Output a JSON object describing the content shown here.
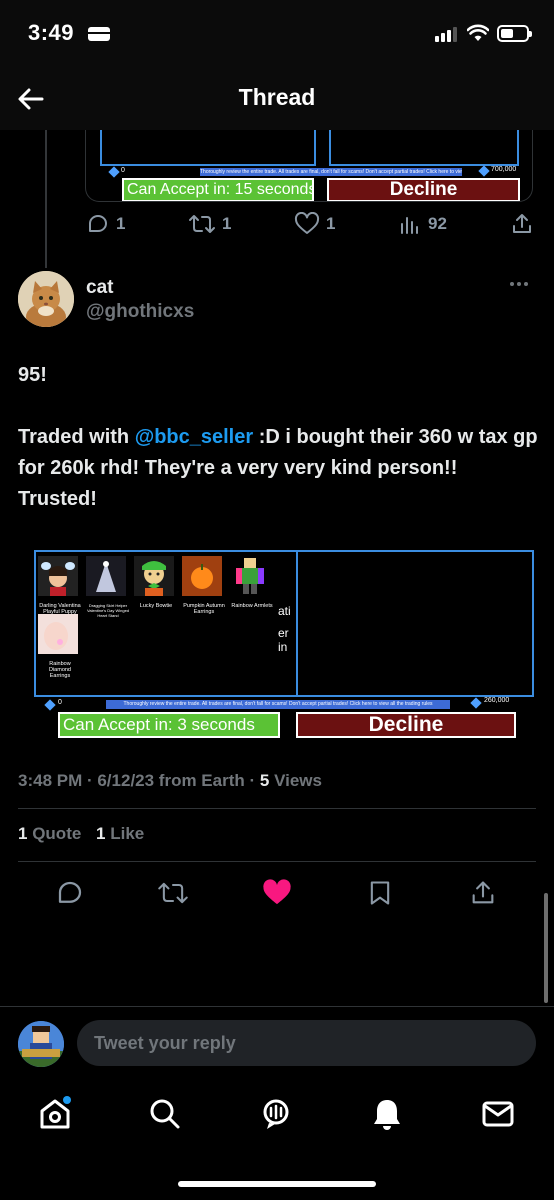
{
  "status_bar": {
    "time": "3:49"
  },
  "header": {
    "title": "Thread"
  },
  "prev_tweet": {
    "trade": {
      "notice": "Thoroughly review the entire trade. All trades are final, don't fall for scams! Don't accept partial trades! Click here to view all the trading rules",
      "left_value": "0",
      "right_value": "700,000",
      "accept_label": "Can Accept in: 15 seconds",
      "decline_label": "Decline"
    },
    "actions": {
      "replies": "1",
      "retweets": "1",
      "likes": "1",
      "views": "92"
    }
  },
  "tweet": {
    "display_name": "cat",
    "handle": "@ghothicxs",
    "line1": "95!",
    "text_before": "Traded with ",
    "mention": "@bbc_seller",
    "text_after": " :D i bought their 360 w tax gp for 260k rhd! They're a very very kind person!! Trusted!",
    "trade": {
      "items": [
        "Darling Valentina Playful Puppy Ears",
        "Dragging Skirt Helper Valentine's Day Winged Heart Stand",
        "Lucky Bowtie",
        "Pumpkin Autumn Earrings",
        "Rainbow Armlets",
        "Rainbow Diamond Earrings"
      ],
      "side_text": [
        "ati",
        "er",
        "in"
      ],
      "notice": "Thoroughly review the entire trade. All trades are final, don't fall for scams! Don't accept partial trades! Click here to view all the trading rules",
      "left_value": "0",
      "right_value": "260,000",
      "accept_label": "Can Accept in: 3 seconds",
      "decline_label": "Decline"
    },
    "meta": {
      "time_date": "3:48 PM · 6/12/23 from Earth · ",
      "views_count": "5",
      "views_label": " Views"
    },
    "stats": {
      "quotes_count": "1",
      "quotes_label": "Quote",
      "likes_count": "1",
      "likes_label": "Like"
    }
  },
  "reply": {
    "placeholder": "Tweet your reply"
  },
  "colors": {
    "accent": "#1d9bf0",
    "like": "#f91880",
    "muted": "#71767b"
  },
  "icons": [
    "back-arrow-icon",
    "reply-icon",
    "retweet-icon",
    "like-icon",
    "views-icon",
    "share-icon",
    "bookmark-icon",
    "home-icon",
    "search-icon",
    "spaces-icon",
    "notifications-icon",
    "messages-icon"
  ]
}
